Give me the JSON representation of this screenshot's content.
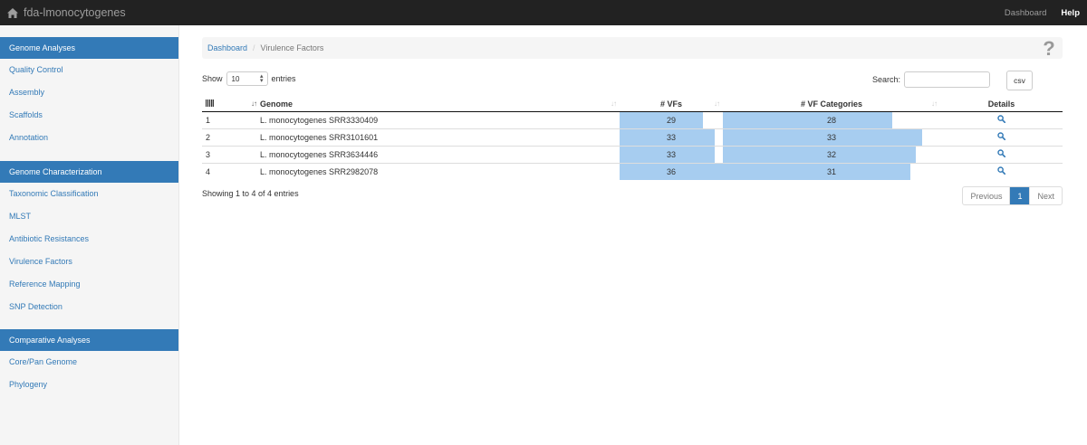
{
  "app": {
    "brand": "fda-lmonocytogenes"
  },
  "topnav": {
    "dashboard": "Dashboard",
    "help": "Help"
  },
  "sidebar": {
    "sections": [
      {
        "title": "Genome Analyses",
        "items": [
          "Quality Control",
          "Assembly",
          "Scaffolds",
          "Annotation"
        ]
      },
      {
        "title": "Genome Characterization",
        "items": [
          "Taxonomic Classification",
          "MLST",
          "Antibiotic Resistances",
          "Virulence Factors",
          "Reference Mapping",
          "SNP Detection"
        ]
      },
      {
        "title": "Comparative Analyses",
        "items": [
          "Core/Pan Genome",
          "Phylogeny"
        ]
      }
    ]
  },
  "breadcrumb": {
    "home": "Dashboard",
    "separator": "/",
    "current": "Virulence Factors"
  },
  "controls": {
    "show": "Show",
    "entries_value": "10",
    "entries": "entries",
    "search": "Search:",
    "csv": "csv"
  },
  "table": {
    "headers": {
      "genome": "Genome",
      "vfs": "# VFs",
      "vf_categories": "# VF Categories",
      "details": "Details"
    },
    "vf_max": 36,
    "vfcat_max": 36,
    "rows": [
      {
        "idx": "1",
        "genome": "L. monocytogenes SRR3330409",
        "vfs": 29,
        "vfcat": 28
      },
      {
        "idx": "2",
        "genome": "L. monocytogenes SRR3101601",
        "vfs": 33,
        "vfcat": 33
      },
      {
        "idx": "3",
        "genome": "L. monocytogenes SRR3634446",
        "vfs": 33,
        "vfcat": 32
      },
      {
        "idx": "4",
        "genome": "L. monocytogenes SRR2982078",
        "vfs": 36,
        "vfcat": 31
      }
    ]
  },
  "footer": {
    "info": "Showing 1 to 4 of 4 entries",
    "previous": "Previous",
    "page": "1",
    "next": "Next"
  },
  "colors": {
    "topbar": "#222222",
    "accent": "#337ab7",
    "bar": "#a7cdf0"
  }
}
